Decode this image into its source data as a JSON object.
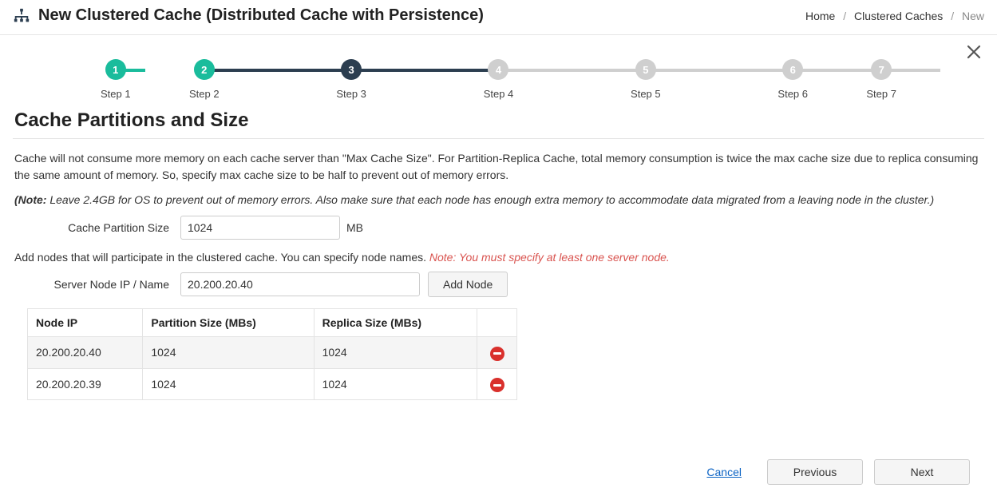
{
  "header": {
    "title": "New Clustered Cache (Distributed Cache with Persistence)"
  },
  "breadcrumb": {
    "home": "Home",
    "caches": "Clustered Caches",
    "current": "New"
  },
  "stepper": {
    "steps": [
      {
        "num": "1",
        "label": "Step 1",
        "state": "done"
      },
      {
        "num": "2",
        "label": "Step 2",
        "state": "done"
      },
      {
        "num": "3",
        "label": "Step 3",
        "state": "current"
      },
      {
        "num": "4",
        "label": "Step 4",
        "state": "pending"
      },
      {
        "num": "5",
        "label": "Step 5",
        "state": "pending"
      },
      {
        "num": "6",
        "label": "Step 6",
        "state": "pending"
      },
      {
        "num": "7",
        "label": "Step 7",
        "state": "pending"
      }
    ]
  },
  "section": {
    "title": "Cache Partitions and Size"
  },
  "text": {
    "description": "Cache will not consume more memory on each cache server than \"Max Cache Size\". For Partition-Replica Cache, total memory consumption is twice the max cache size due to replica consuming the same amount of memory. So, specify max cache size to be half to prevent out of memory errors.",
    "note_label": "(Note:",
    "note_body": " Leave 2.4GB for OS to prevent out of memory errors. Also make sure that each node has enough extra memory to accommodate data migrated from a leaving node in the cluster.)",
    "add_nodes": "Add nodes that will participate in the clustered cache. You can specify node names. ",
    "add_nodes_warn": "Note: You must specify at least one server node."
  },
  "form": {
    "partition_label": "Cache Partition Size",
    "partition_value": "1024",
    "partition_unit": "MB",
    "node_label": "Server Node IP / Name",
    "node_value": "20.200.20.40",
    "add_node_btn": "Add Node"
  },
  "table": {
    "headers": {
      "ip": "Node IP",
      "partition": "Partition Size (MBs)",
      "replica": "Replica Size (MBs)"
    },
    "rows": [
      {
        "ip": "20.200.20.40",
        "partition": "1024",
        "replica": "1024"
      },
      {
        "ip": "20.200.20.39",
        "partition": "1024",
        "replica": "1024"
      }
    ]
  },
  "footer": {
    "cancel": "Cancel",
    "previous": "Previous",
    "next": "Next"
  }
}
